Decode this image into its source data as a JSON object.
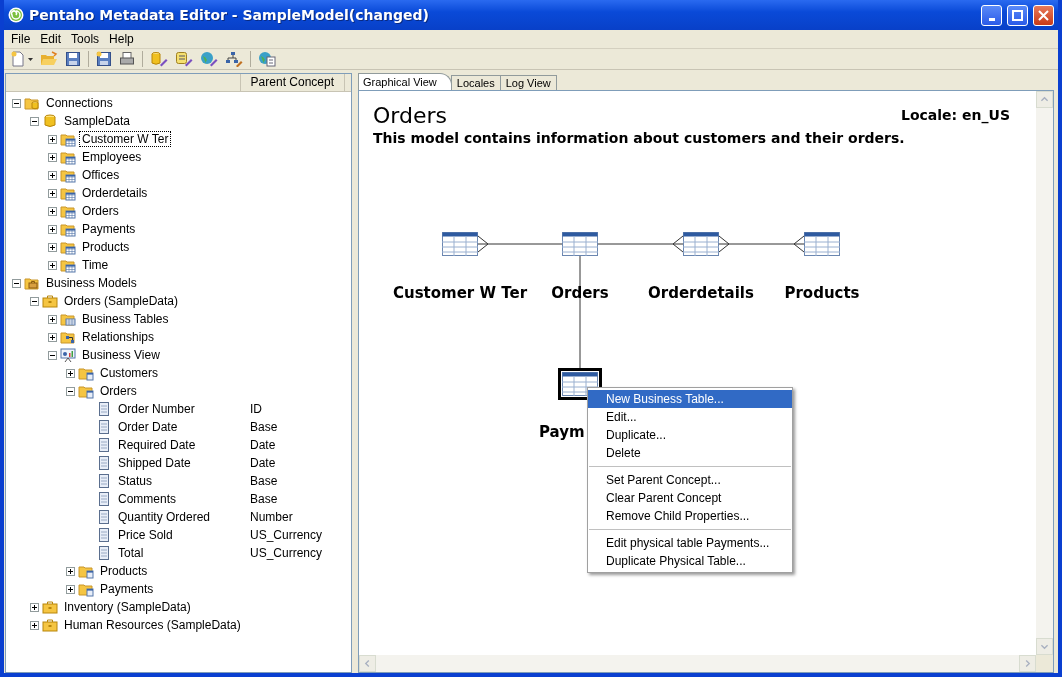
{
  "window": {
    "title": "Pentaho Metadata Editor - SampleModel(changed)"
  },
  "menu_bar": [
    "File",
    "Edit",
    "Tools",
    "Help"
  ],
  "left_panel": {
    "column_header": "Parent Concept",
    "tree": [
      {
        "label": "Connections",
        "kind": "connections",
        "expanded": true,
        "selected": false,
        "children": [
          {
            "label": "SampleData",
            "kind": "database",
            "expanded": true,
            "selected": false,
            "children": [
              {
                "label": "Customer W Ter",
                "kind": "table",
                "expanded": false,
                "selected": true
              },
              {
                "label": "Employees",
                "kind": "table",
                "expanded": false,
                "selected": false
              },
              {
                "label": "Offices",
                "kind": "table",
                "expanded": false,
                "selected": false
              },
              {
                "label": "Orderdetails",
                "kind": "table",
                "expanded": false,
                "selected": false
              },
              {
                "label": "Orders",
                "kind": "table",
                "expanded": false,
                "selected": false
              },
              {
                "label": "Payments",
                "kind": "table",
                "expanded": false,
                "selected": false
              },
              {
                "label": "Products",
                "kind": "table",
                "expanded": false,
                "selected": false
              },
              {
                "label": "Time",
                "kind": "table",
                "expanded": false,
                "selected": false
              }
            ]
          }
        ]
      },
      {
        "label": "Business Models",
        "kind": "models",
        "expanded": true,
        "selected": false,
        "children": [
          {
            "label": "Orders (SampleData)",
            "kind": "model",
            "expanded": true,
            "selected": false,
            "children": [
              {
                "label": "Business Tables",
                "kind": "business-tables",
                "expanded": false,
                "selected": false
              },
              {
                "label": "Relationships",
                "kind": "relationships",
                "expanded": false,
                "selected": false
              },
              {
                "label": "Business View",
                "kind": "business-view",
                "expanded": true,
                "selected": false,
                "children": [
                  {
                    "label": "Customers",
                    "kind": "category",
                    "expanded": false,
                    "selected": false
                  },
                  {
                    "label": "Orders",
                    "kind": "category",
                    "expanded": true,
                    "selected": false,
                    "children": [
                      {
                        "label": "Order Number",
                        "kind": "column",
                        "value": "ID",
                        "selected": false
                      },
                      {
                        "label": "Order Date",
                        "kind": "column",
                        "value": "Base",
                        "selected": false
                      },
                      {
                        "label": "Required Date",
                        "kind": "column",
                        "value": "Date",
                        "selected": false
                      },
                      {
                        "label": "Shipped Date",
                        "kind": "column",
                        "value": "Date",
                        "selected": false
                      },
                      {
                        "label": "Status",
                        "kind": "column",
                        "value": "Base",
                        "selected": false
                      },
                      {
                        "label": "Comments",
                        "kind": "column",
                        "value": "Base",
                        "selected": false
                      },
                      {
                        "label": "Quantity Ordered",
                        "kind": "column",
                        "value": "Number",
                        "selected": false
                      },
                      {
                        "label": "Price Sold",
                        "kind": "column",
                        "value": "US_Currency",
                        "selected": false
                      },
                      {
                        "label": "Total",
                        "kind": "column",
                        "value": "US_Currency",
                        "selected": false
                      }
                    ]
                  },
                  {
                    "label": "Products",
                    "kind": "category",
                    "expanded": false,
                    "selected": false
                  },
                  {
                    "label": "Payments",
                    "kind": "category",
                    "expanded": false,
                    "selected": false
                  }
                ]
              }
            ]
          },
          {
            "label": "Inventory (SampleData)",
            "kind": "model",
            "expanded": false,
            "selected": false
          },
          {
            "label": "Human Resources (SampleData)",
            "kind": "model",
            "expanded": false,
            "selected": false
          }
        ]
      }
    ]
  },
  "tabs": [
    {
      "label": "Graphical View",
      "selected": true
    },
    {
      "label": "Locales",
      "selected": false
    },
    {
      "label": "Log View",
      "selected": false
    }
  ],
  "view": {
    "title": "Orders",
    "locale": "Locale: en_US",
    "description": "This model contains information about customers and their orders.",
    "diagram": {
      "nodes": [
        {
          "label": "Customer W Ter",
          "fork_left": false,
          "fork_right": true,
          "selected": false
        },
        {
          "label": "Orders",
          "fork_left": false,
          "fork_right": false,
          "selected": false
        },
        {
          "label": "Orderdetails",
          "fork_left": true,
          "fork_right": true,
          "selected": false
        },
        {
          "label": "Products",
          "fork_left": true,
          "fork_right": false,
          "selected": false
        },
        {
          "label": "Paym",
          "fork_left": false,
          "fork_right": false,
          "selected": true
        }
      ]
    }
  },
  "context_menu": {
    "groups": [
      [
        {
          "label": "New Business Table...",
          "selected": true
        },
        {
          "label": "Edit...",
          "selected": false
        },
        {
          "label": "Duplicate...",
          "selected": false
        },
        {
          "label": "Delete",
          "selected": false
        }
      ],
      [
        {
          "label": "Set Parent Concept...",
          "selected": false
        },
        {
          "label": "Clear Parent Concept",
          "selected": false
        },
        {
          "label": "Remove Child Properties...",
          "selected": false
        }
      ],
      [
        {
          "label": "Edit physical table Payments...",
          "selected": false
        },
        {
          "label": "Duplicate Physical Table...",
          "selected": false
        }
      ]
    ]
  }
}
